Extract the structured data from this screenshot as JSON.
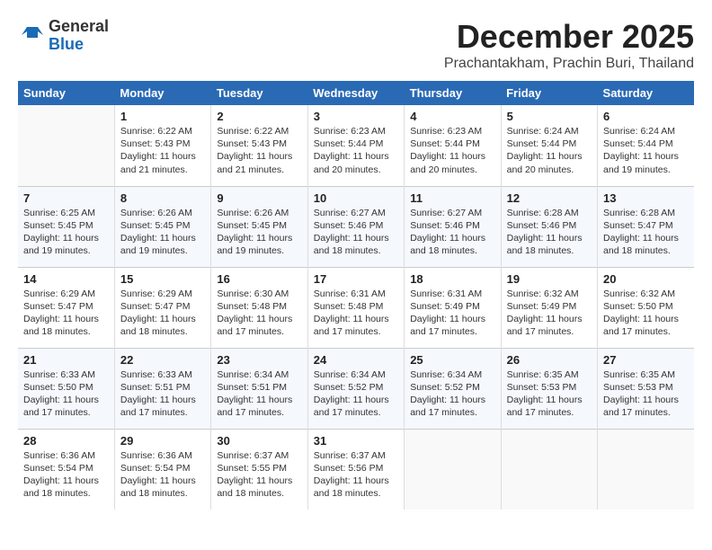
{
  "header": {
    "logo_general": "General",
    "logo_blue": "Blue",
    "month": "December 2025",
    "location": "Prachantakham, Prachin Buri, Thailand"
  },
  "days_of_week": [
    "Sunday",
    "Monday",
    "Tuesday",
    "Wednesday",
    "Thursday",
    "Friday",
    "Saturday"
  ],
  "weeks": [
    [
      {
        "day": "",
        "info": ""
      },
      {
        "day": "1",
        "info": "Sunrise: 6:22 AM\nSunset: 5:43 PM\nDaylight: 11 hours\nand 21 minutes."
      },
      {
        "day": "2",
        "info": "Sunrise: 6:22 AM\nSunset: 5:43 PM\nDaylight: 11 hours\nand 21 minutes."
      },
      {
        "day": "3",
        "info": "Sunrise: 6:23 AM\nSunset: 5:44 PM\nDaylight: 11 hours\nand 20 minutes."
      },
      {
        "day": "4",
        "info": "Sunrise: 6:23 AM\nSunset: 5:44 PM\nDaylight: 11 hours\nand 20 minutes."
      },
      {
        "day": "5",
        "info": "Sunrise: 6:24 AM\nSunset: 5:44 PM\nDaylight: 11 hours\nand 20 minutes."
      },
      {
        "day": "6",
        "info": "Sunrise: 6:24 AM\nSunset: 5:44 PM\nDaylight: 11 hours\nand 19 minutes."
      }
    ],
    [
      {
        "day": "7",
        "info": "Sunrise: 6:25 AM\nSunset: 5:45 PM\nDaylight: 11 hours\nand 19 minutes."
      },
      {
        "day": "8",
        "info": "Sunrise: 6:26 AM\nSunset: 5:45 PM\nDaylight: 11 hours\nand 19 minutes."
      },
      {
        "day": "9",
        "info": "Sunrise: 6:26 AM\nSunset: 5:45 PM\nDaylight: 11 hours\nand 19 minutes."
      },
      {
        "day": "10",
        "info": "Sunrise: 6:27 AM\nSunset: 5:46 PM\nDaylight: 11 hours\nand 18 minutes."
      },
      {
        "day": "11",
        "info": "Sunrise: 6:27 AM\nSunset: 5:46 PM\nDaylight: 11 hours\nand 18 minutes."
      },
      {
        "day": "12",
        "info": "Sunrise: 6:28 AM\nSunset: 5:46 PM\nDaylight: 11 hours\nand 18 minutes."
      },
      {
        "day": "13",
        "info": "Sunrise: 6:28 AM\nSunset: 5:47 PM\nDaylight: 11 hours\nand 18 minutes."
      }
    ],
    [
      {
        "day": "14",
        "info": "Sunrise: 6:29 AM\nSunset: 5:47 PM\nDaylight: 11 hours\nand 18 minutes."
      },
      {
        "day": "15",
        "info": "Sunrise: 6:29 AM\nSunset: 5:47 PM\nDaylight: 11 hours\nand 18 minutes."
      },
      {
        "day": "16",
        "info": "Sunrise: 6:30 AM\nSunset: 5:48 PM\nDaylight: 11 hours\nand 17 minutes."
      },
      {
        "day": "17",
        "info": "Sunrise: 6:31 AM\nSunset: 5:48 PM\nDaylight: 11 hours\nand 17 minutes."
      },
      {
        "day": "18",
        "info": "Sunrise: 6:31 AM\nSunset: 5:49 PM\nDaylight: 11 hours\nand 17 minutes."
      },
      {
        "day": "19",
        "info": "Sunrise: 6:32 AM\nSunset: 5:49 PM\nDaylight: 11 hours\nand 17 minutes."
      },
      {
        "day": "20",
        "info": "Sunrise: 6:32 AM\nSunset: 5:50 PM\nDaylight: 11 hours\nand 17 minutes."
      }
    ],
    [
      {
        "day": "21",
        "info": "Sunrise: 6:33 AM\nSunset: 5:50 PM\nDaylight: 11 hours\nand 17 minutes."
      },
      {
        "day": "22",
        "info": "Sunrise: 6:33 AM\nSunset: 5:51 PM\nDaylight: 11 hours\nand 17 minutes."
      },
      {
        "day": "23",
        "info": "Sunrise: 6:34 AM\nSunset: 5:51 PM\nDaylight: 11 hours\nand 17 minutes."
      },
      {
        "day": "24",
        "info": "Sunrise: 6:34 AM\nSunset: 5:52 PM\nDaylight: 11 hours\nand 17 minutes."
      },
      {
        "day": "25",
        "info": "Sunrise: 6:34 AM\nSunset: 5:52 PM\nDaylight: 11 hours\nand 17 minutes."
      },
      {
        "day": "26",
        "info": "Sunrise: 6:35 AM\nSunset: 5:53 PM\nDaylight: 11 hours\nand 17 minutes."
      },
      {
        "day": "27",
        "info": "Sunrise: 6:35 AM\nSunset: 5:53 PM\nDaylight: 11 hours\nand 17 minutes."
      }
    ],
    [
      {
        "day": "28",
        "info": "Sunrise: 6:36 AM\nSunset: 5:54 PM\nDaylight: 11 hours\nand 18 minutes."
      },
      {
        "day": "29",
        "info": "Sunrise: 6:36 AM\nSunset: 5:54 PM\nDaylight: 11 hours\nand 18 minutes."
      },
      {
        "day": "30",
        "info": "Sunrise: 6:37 AM\nSunset: 5:55 PM\nDaylight: 11 hours\nand 18 minutes."
      },
      {
        "day": "31",
        "info": "Sunrise: 6:37 AM\nSunset: 5:56 PM\nDaylight: 11 hours\nand 18 minutes."
      },
      {
        "day": "",
        "info": ""
      },
      {
        "day": "",
        "info": ""
      },
      {
        "day": "",
        "info": ""
      }
    ]
  ]
}
